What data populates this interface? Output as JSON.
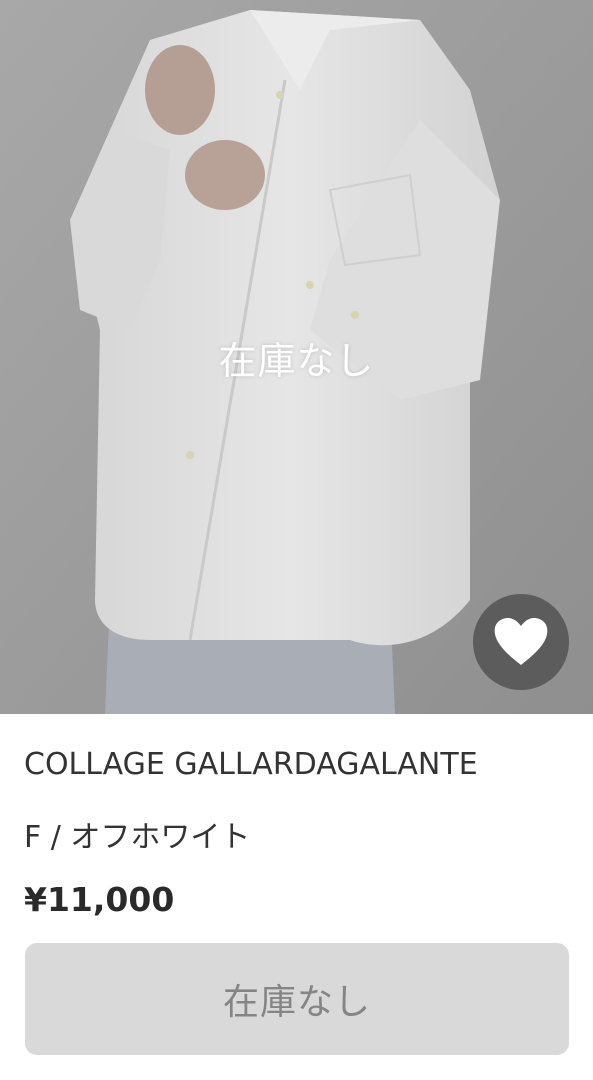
{
  "product": {
    "sold_overlay_label": "在庫なし",
    "brand": "COLLAGE GALLARDAGALANTE",
    "variant": "F / オフホワイト",
    "price": "¥11,000",
    "sold_button_label": "在庫なし",
    "favorite_icon": "heart-icon"
  },
  "colors": {
    "overlay_dim": "#9a9a9a",
    "shirt": "#e2e2e2",
    "favorite_bg": "#505050",
    "button_bg": "#d9d9d9",
    "button_text": "#858585",
    "text": "#333333"
  }
}
